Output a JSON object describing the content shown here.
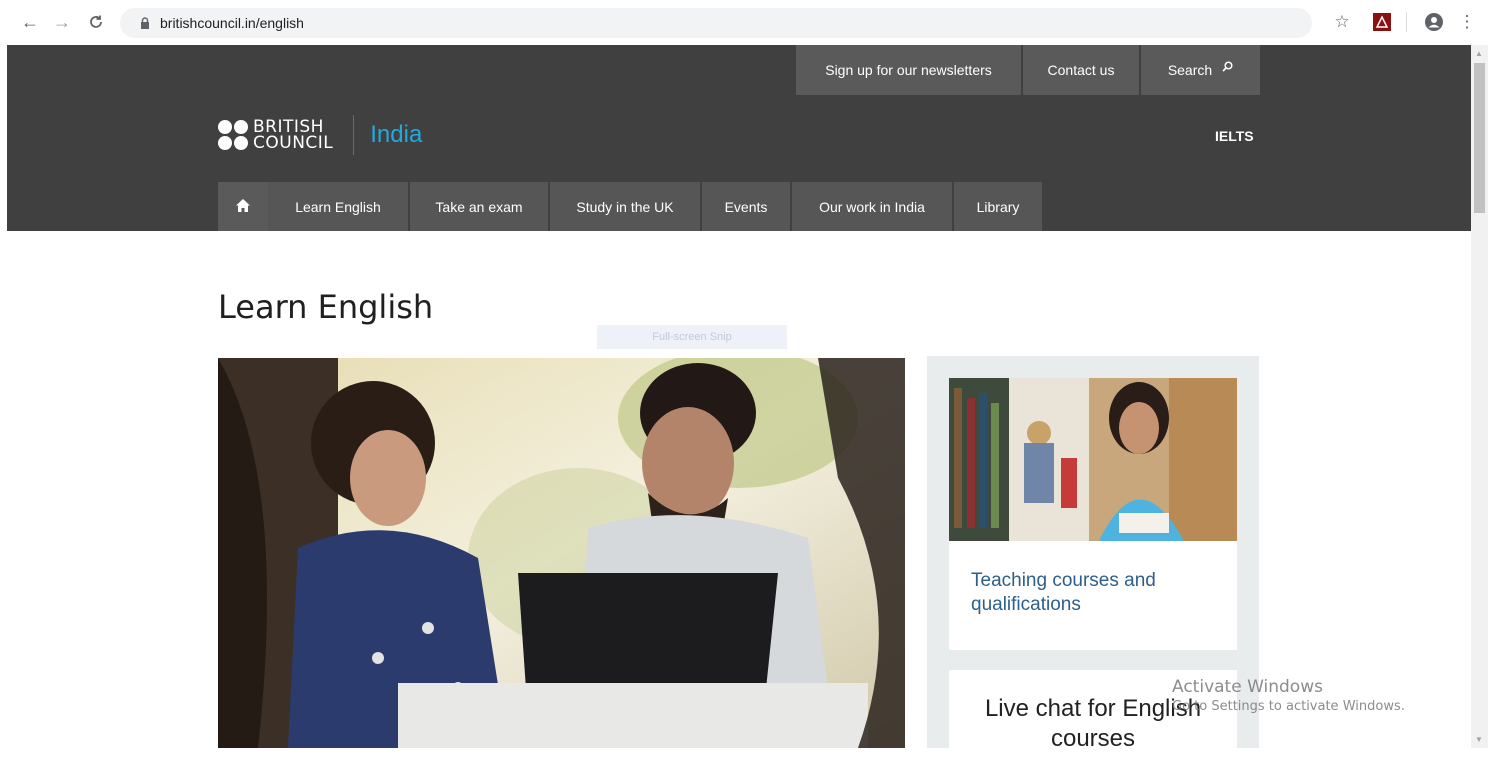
{
  "browser": {
    "url": "britishcouncil.in/english"
  },
  "header": {
    "top_links": [
      "Sign up for our newsletters",
      "Contact us",
      "Search"
    ],
    "logo_line1": "BRITISH",
    "logo_line2": "COUNCIL",
    "country": "India",
    "ielts": "IELTS",
    "nav": [
      "Learn English",
      "Take an exam",
      "Study in the UK",
      "Events",
      "Our work in India",
      "Library"
    ]
  },
  "main": {
    "title": "Learn English",
    "snip_overlay": "Full-screen Snip"
  },
  "sidebar": {
    "card1_title": "Teaching courses and qualifications",
    "card2_title": "Live chat for English courses"
  },
  "watermark": {
    "title": "Activate Windows",
    "subtitle": "Go to Settings to activate Windows."
  },
  "colors": {
    "header_bg": "#404040",
    "accent_blue": "#23a8e0",
    "link_blue": "#2d5f8a"
  }
}
